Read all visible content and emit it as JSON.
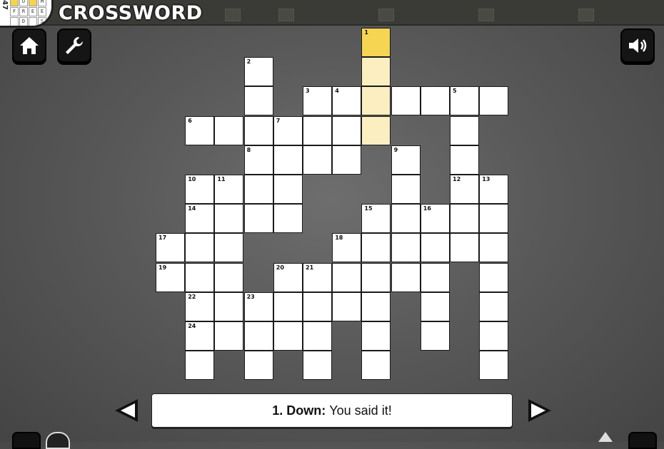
{
  "app": {
    "title": "CROSSWORD",
    "logo": {
      "number": "47",
      "letters": [
        "",
        "O",
        "",
        "M",
        "F",
        "R",
        "E",
        "E",
        "",
        "D",
        "",
        "S"
      ]
    }
  },
  "toolbar": {
    "home_icon": "home-icon",
    "settings_icon": "wrench-icon",
    "sound_icon": "speaker-icon"
  },
  "colors": {
    "active": "#f5d552",
    "highlight": "#fbefc1",
    "cell": "#ffffff",
    "border": "#1a1a1a"
  },
  "grid": {
    "active_cell": [
      0,
      7
    ],
    "highlighted_cells": [
      [
        1,
        7
      ],
      [
        2,
        7
      ],
      [
        3,
        7
      ]
    ],
    "cells": [
      [
        0,
        7,
        "1"
      ],
      [
        1,
        3,
        "2"
      ],
      [
        1,
        7,
        ""
      ],
      [
        2,
        3,
        ""
      ],
      [
        2,
        5,
        "3"
      ],
      [
        2,
        6,
        "4"
      ],
      [
        2,
        7,
        ""
      ],
      [
        2,
        8,
        ""
      ],
      [
        2,
        9,
        ""
      ],
      [
        2,
        10,
        "5"
      ],
      [
        2,
        11,
        ""
      ],
      [
        3,
        1,
        "6"
      ],
      [
        3,
        2,
        ""
      ],
      [
        3,
        3,
        ""
      ],
      [
        3,
        4,
        "7"
      ],
      [
        3,
        5,
        ""
      ],
      [
        3,
        6,
        ""
      ],
      [
        3,
        7,
        ""
      ],
      [
        3,
        10,
        ""
      ],
      [
        4,
        3,
        "8"
      ],
      [
        4,
        4,
        ""
      ],
      [
        4,
        5,
        ""
      ],
      [
        4,
        6,
        ""
      ],
      [
        4,
        8,
        "9"
      ],
      [
        4,
        10,
        ""
      ],
      [
        5,
        1,
        "10"
      ],
      [
        5,
        2,
        "11"
      ],
      [
        5,
        3,
        ""
      ],
      [
        5,
        4,
        ""
      ],
      [
        5,
        8,
        ""
      ],
      [
        5,
        10,
        "12"
      ],
      [
        5,
        11,
        "13"
      ],
      [
        6,
        1,
        "14"
      ],
      [
        6,
        2,
        ""
      ],
      [
        6,
        3,
        ""
      ],
      [
        6,
        4,
        ""
      ],
      [
        6,
        7,
        "15"
      ],
      [
        6,
        8,
        ""
      ],
      [
        6,
        9,
        "16"
      ],
      [
        6,
        10,
        ""
      ],
      [
        6,
        11,
        ""
      ],
      [
        7,
        0,
        "17"
      ],
      [
        7,
        1,
        ""
      ],
      [
        7,
        2,
        ""
      ],
      [
        7,
        6,
        "18"
      ],
      [
        7,
        7,
        ""
      ],
      [
        7,
        8,
        ""
      ],
      [
        7,
        9,
        ""
      ],
      [
        7,
        10,
        ""
      ],
      [
        7,
        11,
        ""
      ],
      [
        8,
        0,
        "19"
      ],
      [
        8,
        1,
        ""
      ],
      [
        8,
        2,
        ""
      ],
      [
        8,
        4,
        "20"
      ],
      [
        8,
        5,
        "21"
      ],
      [
        8,
        6,
        ""
      ],
      [
        8,
        7,
        ""
      ],
      [
        8,
        8,
        ""
      ],
      [
        8,
        9,
        ""
      ],
      [
        8,
        11,
        ""
      ],
      [
        9,
        1,
        "22"
      ],
      [
        9,
        2,
        ""
      ],
      [
        9,
        3,
        "23"
      ],
      [
        9,
        4,
        ""
      ],
      [
        9,
        5,
        ""
      ],
      [
        9,
        6,
        ""
      ],
      [
        9,
        7,
        ""
      ],
      [
        9,
        9,
        ""
      ],
      [
        9,
        11,
        ""
      ],
      [
        10,
        1,
        "24"
      ],
      [
        10,
        2,
        ""
      ],
      [
        10,
        3,
        ""
      ],
      [
        10,
        4,
        ""
      ],
      [
        10,
        5,
        ""
      ],
      [
        10,
        7,
        ""
      ],
      [
        10,
        9,
        ""
      ],
      [
        10,
        11,
        ""
      ],
      [
        11,
        1,
        ""
      ],
      [
        11,
        3,
        ""
      ],
      [
        11,
        5,
        ""
      ],
      [
        11,
        7,
        ""
      ],
      [
        11,
        11,
        ""
      ]
    ]
  },
  "clue": {
    "label": "1. Down:",
    "text": "You said it!"
  },
  "nav": {
    "prev_icon": "left-arrow-icon",
    "next_icon": "right-arrow-icon"
  }
}
